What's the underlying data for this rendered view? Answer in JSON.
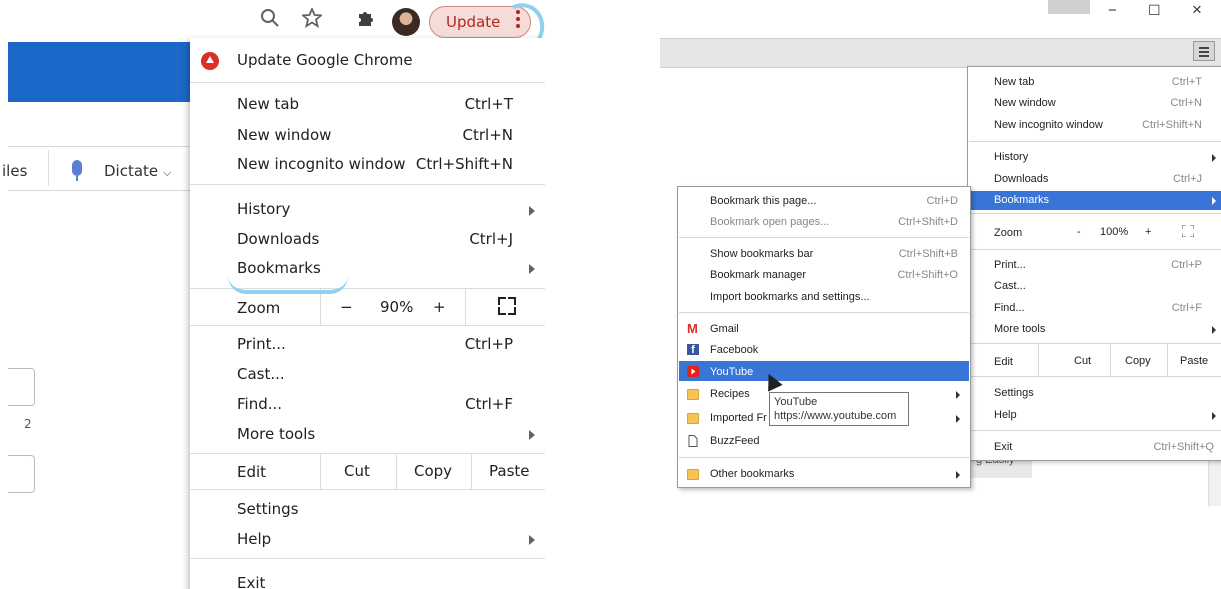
{
  "left_panel": {
    "toolbar": {
      "search_icon": "search-icon",
      "star_icon": "star-icon",
      "extensions_icon": "puzzle-icon",
      "update_label": "Update"
    },
    "docs_toolbar": {
      "files_fragment": "iles",
      "dictate_label": "Dictate"
    },
    "ruler_number": "2",
    "menu": {
      "update_chrome": "Update Google Chrome",
      "new_tab": "New tab",
      "new_tab_sc": "Ctrl+T",
      "new_window": "New window",
      "new_window_sc": "Ctrl+N",
      "new_incognito": "New incognito window",
      "new_incognito_sc": "Ctrl+Shift+N",
      "history": "History",
      "downloads": "Downloads",
      "downloads_sc": "Ctrl+J",
      "bookmarks": "Bookmarks",
      "zoom": "Zoom",
      "zoom_minus": "−",
      "zoom_value": "90%",
      "zoom_plus": "+",
      "print": "Print...",
      "print_sc": "Ctrl+P",
      "cast": "Cast...",
      "find": "Find...",
      "find_sc": "Ctrl+F",
      "more_tools": "More tools",
      "edit": "Edit",
      "cut": "Cut",
      "copy": "Copy",
      "paste": "Paste",
      "settings": "Settings",
      "help": "Help",
      "exit": "Exit"
    }
  },
  "right_panel": {
    "window_controls": {
      "minimize": "−",
      "maximize": "☐",
      "close": "×"
    },
    "background_text": "g Easily",
    "chrome_menu": {
      "new_tab": "New tab",
      "new_tab_sc": "Ctrl+T",
      "new_window": "New window",
      "new_window_sc": "Ctrl+N",
      "new_incognito": "New incognito window",
      "new_incognito_sc": "Ctrl+Shift+N",
      "history": "History",
      "downloads": "Downloads",
      "downloads_sc": "Ctrl+J",
      "bookmarks": "Bookmarks",
      "zoom": "Zoom",
      "zoom_minus": "-",
      "zoom_value": "100%",
      "zoom_plus": "+",
      "print": "Print...",
      "print_sc": "Ctrl+P",
      "cast": "Cast...",
      "find": "Find...",
      "find_sc": "Ctrl+F",
      "more_tools": "More tools",
      "edit": "Edit",
      "cut": "Cut",
      "copy": "Copy",
      "paste": "Paste",
      "settings": "Settings",
      "help": "Help",
      "exit": "Exit",
      "exit_sc": "Ctrl+Shift+Q"
    },
    "bookmarks_menu": {
      "bookmark_page": "Bookmark this page...",
      "bookmark_page_sc": "Ctrl+D",
      "bookmark_open": "Bookmark open pages...",
      "bookmark_open_sc": "Ctrl+Shift+D",
      "show_bar": "Show bookmarks bar",
      "show_bar_sc": "Ctrl+Shift+B",
      "manager": "Bookmark manager",
      "manager_sc": "Ctrl+Shift+O",
      "import": "Import bookmarks and settings...",
      "gmail": "Gmail",
      "facebook": "Facebook",
      "youtube": "YouTube",
      "recipes": "Recipes",
      "imported": "Imported Fr",
      "buzzfeed": "BuzzFeed",
      "other": "Other bookmarks"
    },
    "tooltip": {
      "title": "YouTube",
      "url": "https://www.youtube.com"
    },
    "colors": {
      "highlight": "#3875d7",
      "gmail_red": "#d93025",
      "facebook_blue": "#3b5998",
      "youtube_red": "#e62117",
      "folder_yellow": "#f6c453"
    }
  }
}
